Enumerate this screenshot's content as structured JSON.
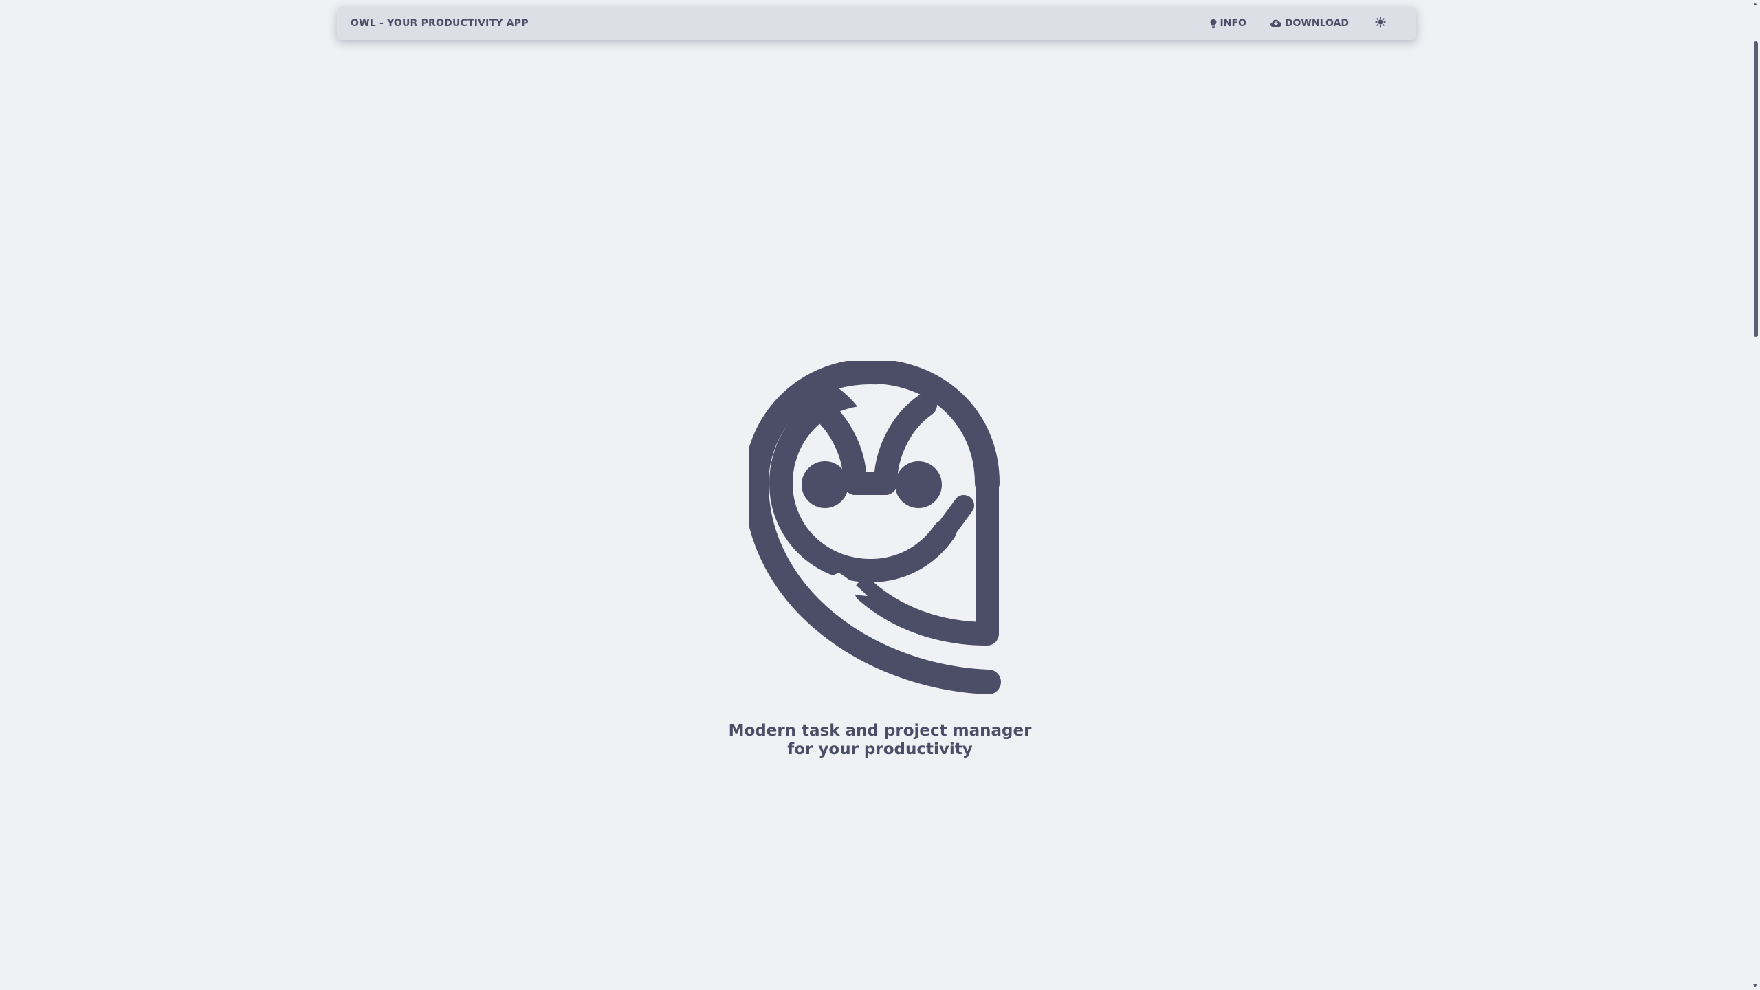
{
  "header": {
    "brand": "OWL - YOUR PRODUCTIVITY APP",
    "nav": [
      {
        "label": "INFO",
        "icon": "lightbulb-icon"
      },
      {
        "label": "DOWNLOAD",
        "icon": "cloud-download-icon"
      }
    ],
    "theme_icon": "sun-icon"
  },
  "hero": {
    "logo": "owl-logo",
    "tagline_line1": "Modern task and project manager",
    "tagline_line2": "for your productivity"
  },
  "colors": {
    "background": "#eff1f5",
    "topbar": "#dcdfe6",
    "foreground": "#4b4e66"
  }
}
